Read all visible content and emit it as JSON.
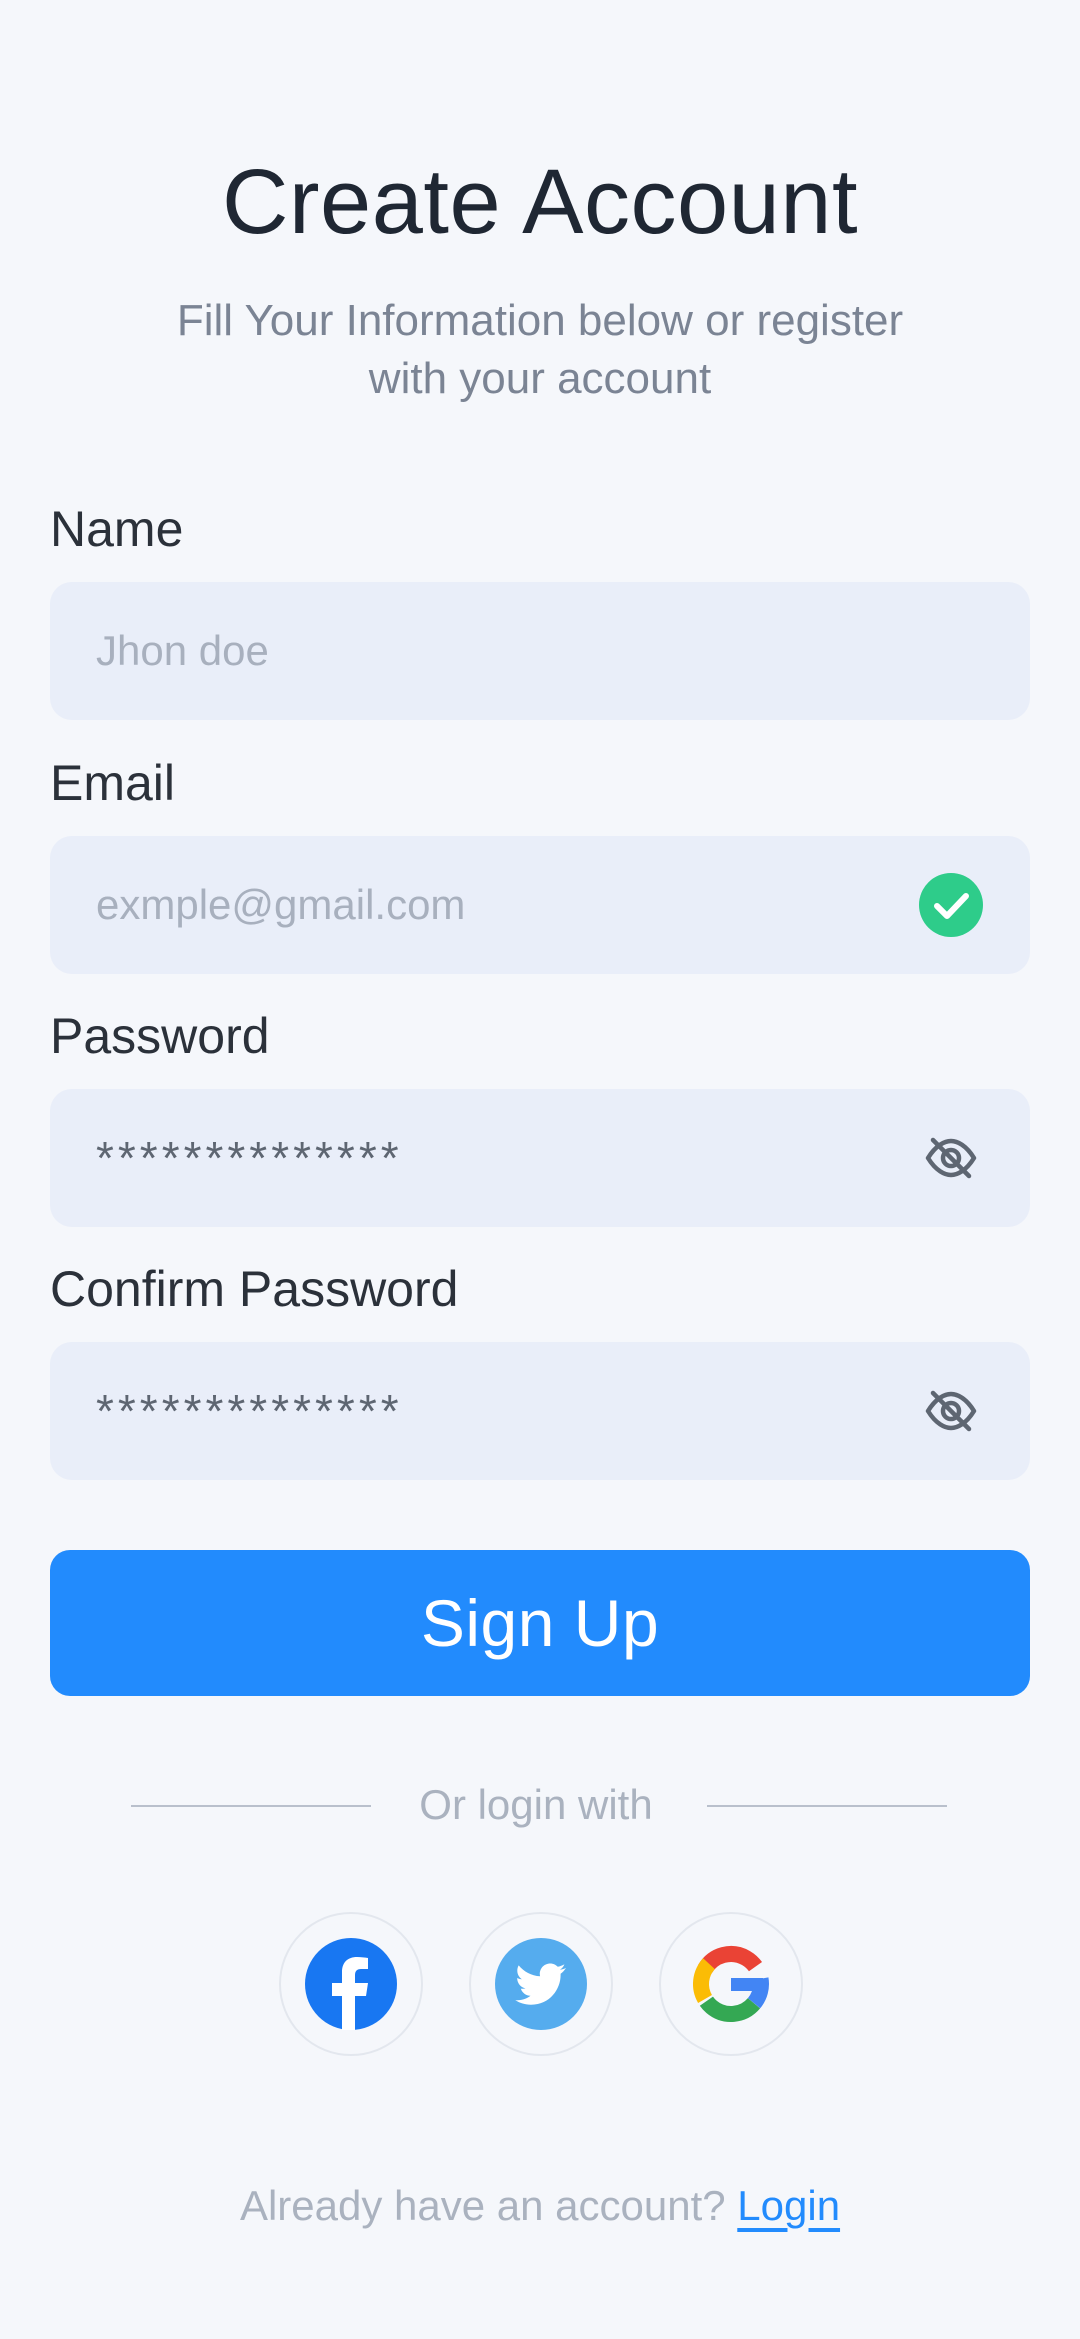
{
  "header": {
    "title": "Create Account",
    "subtitle": "Fill Your Information below or register with your account"
  },
  "form": {
    "name": {
      "label": "Name",
      "placeholder": "Jhon doe"
    },
    "email": {
      "label": "Email",
      "placeholder": "exmple@gmail.com",
      "status_icon": "check-circle-icon"
    },
    "password": {
      "label": "Password",
      "value": "**************",
      "toggle_icon": "eye-off-icon"
    },
    "confirm_password": {
      "label": "Confirm Password",
      "value": "**************",
      "toggle_icon": "eye-off-icon"
    }
  },
  "signup_button": {
    "label": "Sign Up"
  },
  "divider": {
    "label": "Or login with"
  },
  "social": [
    {
      "name": "facebook-icon",
      "color": "#1877f2"
    },
    {
      "name": "twitter-icon",
      "color": "#55acee"
    },
    {
      "name": "google-icon",
      "colors": [
        "#ea4335",
        "#fbbc05",
        "#34a853",
        "#4285f4"
      ]
    }
  ],
  "footer": {
    "prompt": "Already have an account?",
    "link": "Login"
  },
  "colors": {
    "accent": "#228bfd",
    "success": "#2ecc8a",
    "background": "#f5f7fb",
    "field": "#e9eef9"
  }
}
